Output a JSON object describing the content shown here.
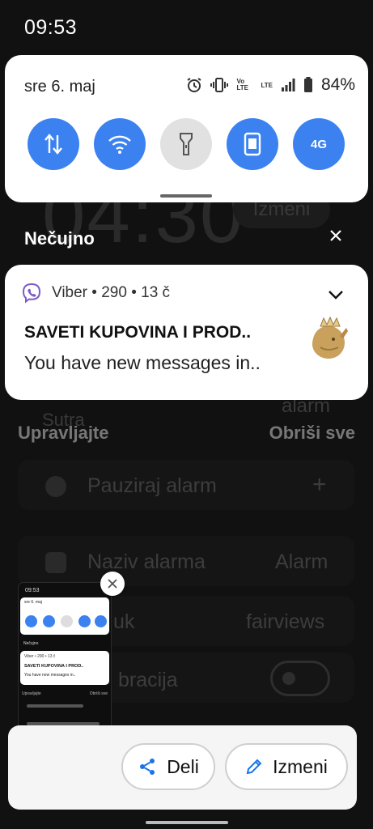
{
  "status_bar": {
    "time": "09:53"
  },
  "quick_settings": {
    "date": "sre 6. maj",
    "battery_percent": "84%",
    "network_labels": [
      "Vo LTE",
      "LTE"
    ],
    "tiles": [
      {
        "name": "mobile-data",
        "state": "on",
        "icon": "data-arrows-icon"
      },
      {
        "name": "wifi",
        "state": "on",
        "icon": "wifi-icon"
      },
      {
        "name": "flashlight",
        "state": "off",
        "icon": "flashlight-icon"
      },
      {
        "name": "screen-rotate",
        "state": "on",
        "icon": "phone-rotate-icon"
      },
      {
        "name": "4g",
        "state": "on",
        "icon": "4g-icon",
        "label": "4G"
      }
    ],
    "accent_color": "#3b82f0"
  },
  "silent_section": {
    "label": "Nečujno"
  },
  "notification": {
    "app_meta": "Viber • 290 • 13 č",
    "title": "SAVETI KUPOVINA I PROD..",
    "body": "You have new messages in.."
  },
  "manage_row": {
    "manage_label": "Upravljajte",
    "clear_label": "Obriši sve"
  },
  "background": {
    "clock": "04:30",
    "edit_label": "Izmeni",
    "tomorrow": "Sutra",
    "alarm_word": "alarm",
    "rows": [
      {
        "label": "Pauziraj alarm",
        "value": "+"
      },
      {
        "label": "Naziv alarma",
        "value": "Alarm"
      },
      {
        "label": "uk",
        "value": "fairviews"
      },
      {
        "label": "bracija",
        "value": ""
      }
    ]
  },
  "screenshot_thumbnail": {
    "time": "09:53",
    "date": "sre 6. maj",
    "silent": "Nečujno",
    "meta": "Viber • 290 • 13 č",
    "title": "SAVETI KUPOVINA I PROD..",
    "body": "You have new messages in..",
    "manage": "Upravljajte",
    "clear": "Obriši sve"
  },
  "toolbar": {
    "share_label": "Deli",
    "edit_label": "Izmeni"
  }
}
